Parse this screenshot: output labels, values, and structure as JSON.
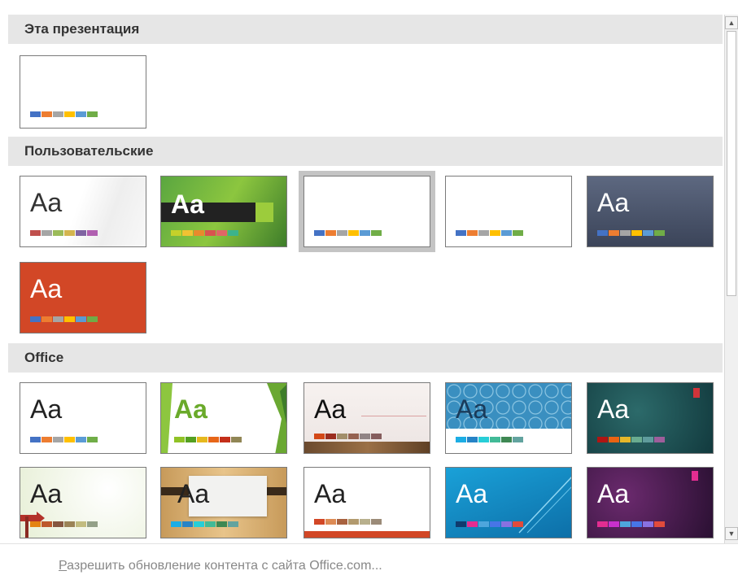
{
  "sections": {
    "this_presentation": "Эта презентация",
    "custom": "Пользовательские",
    "office": "Office"
  },
  "aa_label": "Aa",
  "footer": {
    "first_letter": "Р",
    "rest": "азрешить обновление контента с сайта Office.com..."
  },
  "colors": {
    "header_bg": "#e6e6e6",
    "thumb_border": "#7a7a7a",
    "selected_outline": "#c4c4c4"
  },
  "themes": {
    "this_presentation": [
      {
        "name": "current-theme",
        "has_label": false,
        "selected": false
      }
    ],
    "custom": [
      {
        "name": "custom-white",
        "has_label": true
      },
      {
        "name": "custom-green",
        "has_label": true
      },
      {
        "name": "custom-blank-selected",
        "has_label": false,
        "selected": true
      },
      {
        "name": "custom-blank",
        "has_label": false
      },
      {
        "name": "custom-slate",
        "has_label": true
      },
      {
        "name": "custom-orange",
        "has_label": true
      }
    ],
    "office": [
      {
        "name": "office-theme",
        "has_label": true
      },
      {
        "name": "facet",
        "has_label": true
      },
      {
        "name": "wood-type",
        "has_label": true
      },
      {
        "name": "ion-pattern",
        "has_label": true
      },
      {
        "name": "ion-teal",
        "has_label": true
      },
      {
        "name": "retrospect",
        "has_label": true
      },
      {
        "name": "savon",
        "has_label": true
      },
      {
        "name": "banded",
        "has_label": true
      },
      {
        "name": "blue-streak",
        "has_label": true
      },
      {
        "name": "purple-badge",
        "has_label": true
      }
    ]
  }
}
